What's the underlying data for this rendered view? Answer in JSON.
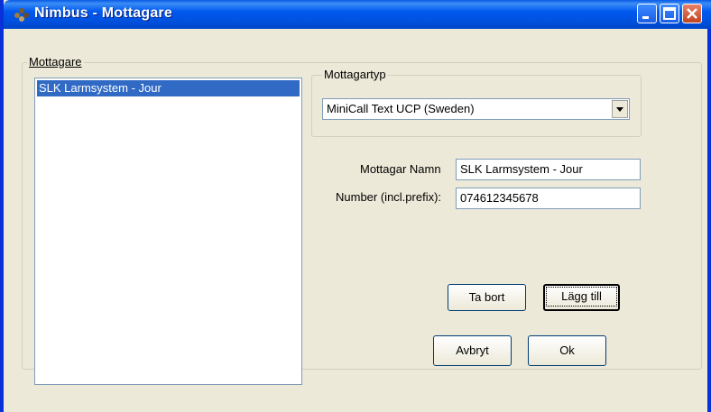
{
  "window": {
    "title": "Nimbus - Mottagare"
  },
  "recipients_group": {
    "legend": "Mottagare",
    "items": [
      {
        "label": "SLK Larmsystem - Jour",
        "selected": true
      }
    ]
  },
  "type_group": {
    "legend": "Mottagartyp",
    "selected": "MiniCall Text UCP (Sweden)"
  },
  "form": {
    "name_label": "Mottagar Namn",
    "name_value": "SLK Larmsystem - Jour",
    "number_label": "Number (incl.prefix):",
    "number_value": "074612345678"
  },
  "buttons": {
    "remove": "Ta bort",
    "add": "Lägg till",
    "cancel": "Avbryt",
    "ok": "Ok"
  },
  "colors": {
    "titlebar": "#0058ee",
    "selection": "#316ac5",
    "dialog_bg": "#ece9d8"
  }
}
